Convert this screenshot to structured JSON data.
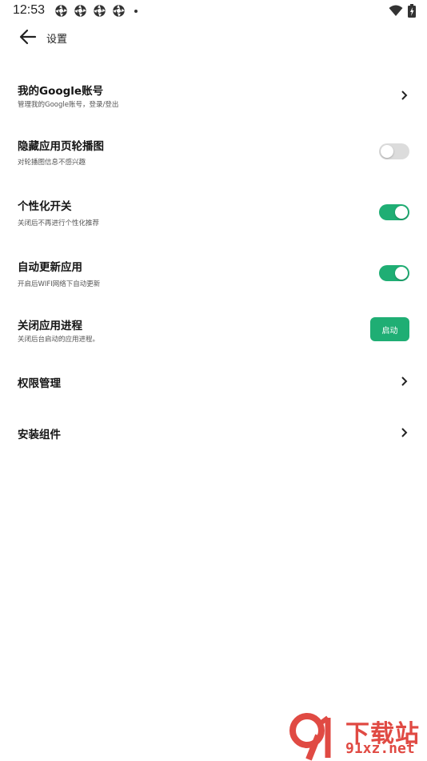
{
  "status": {
    "time": "12:53",
    "notification_icons": [
      "settings-notification-icon",
      "settings-notification-icon",
      "settings-notification-icon",
      "settings-notification-icon"
    ],
    "system_icons": [
      "wifi-icon",
      "battery-icon"
    ]
  },
  "header": {
    "title": "设置",
    "back_icon": "back-arrow-icon"
  },
  "settings": {
    "google_account": {
      "title": "我的Google账号",
      "subtitle": "管理我的Google账号，登录/登出"
    },
    "hide_carousel": {
      "title": "隐藏应用页轮播图",
      "subtitle": "对轮播图信息不感兴趣",
      "enabled": false
    },
    "personalization": {
      "title": "个性化开关",
      "subtitle": "关闭后不再进行个性化推荐",
      "enabled": true
    },
    "auto_update": {
      "title": "自动更新应用",
      "subtitle": "开启后WIFI网络下自动更新",
      "enabled": true
    },
    "close_process": {
      "title": "关闭应用进程",
      "subtitle": "关闭后台启动的应用进程。",
      "button_label": "启动"
    },
    "permissions": {
      "title": "权限管理"
    },
    "install_components": {
      "title": "安装组件"
    }
  },
  "watermark": {
    "top_text": "下载站",
    "bottom_text": "91xz.net"
  },
  "colors": {
    "accent": "#1fae74",
    "toggle_off": "#dcdcdc",
    "watermark": "#e04a43"
  }
}
